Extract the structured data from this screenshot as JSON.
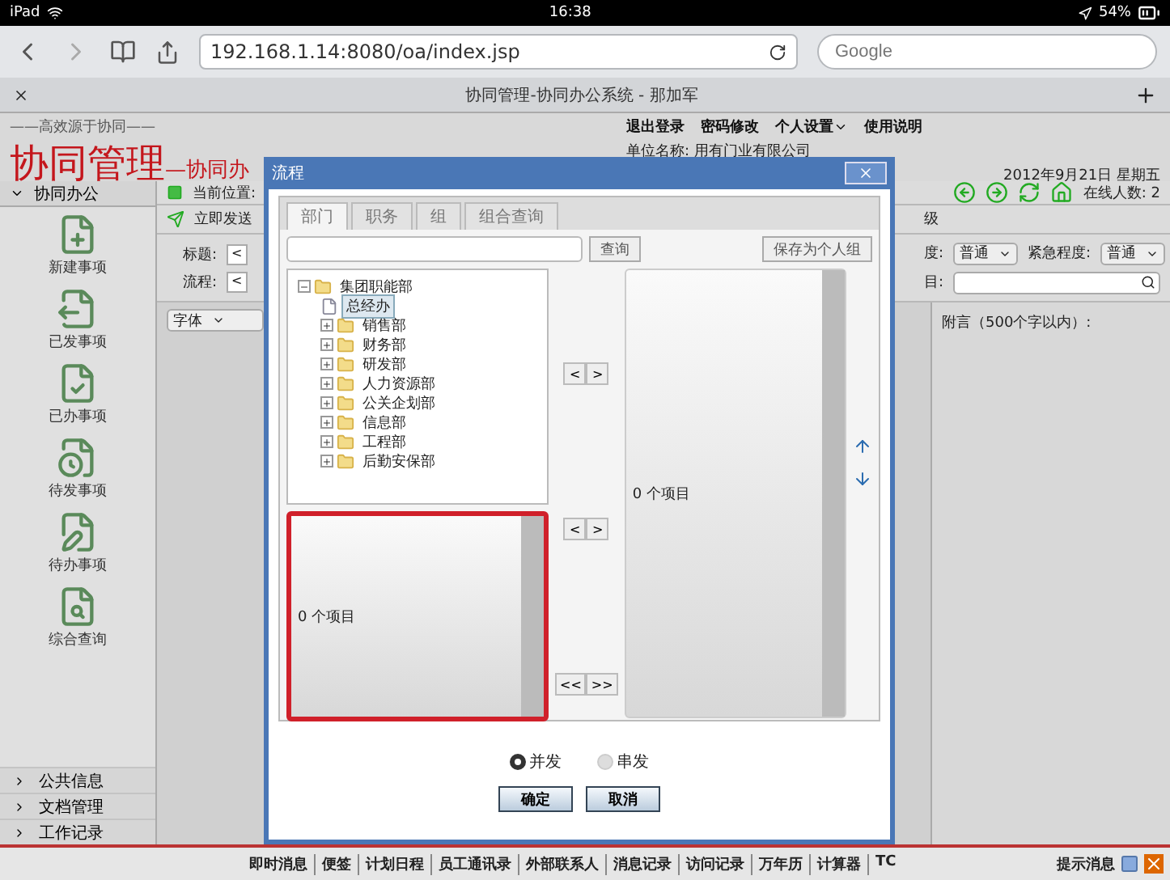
{
  "status_bar": {
    "device": "iPad",
    "time": "16:38",
    "battery": "54%"
  },
  "browser": {
    "url": "192.168.1.14:8080/oa/index.jsp",
    "search_placeholder": "Google",
    "tab_title": "协同管理-协同办公系统 - 那加军"
  },
  "header": {
    "tagline": "——高效源于协同——",
    "logo": "协同管理",
    "subtitle": "—协同办",
    "links": [
      {
        "label": "退出登录",
        "kind": "link"
      },
      {
        "label": "密码修改",
        "kind": "link"
      },
      {
        "label": "个人设置",
        "kind": "menu"
      },
      {
        "label": "使用说明",
        "kind": "link"
      }
    ],
    "company_label": "单位名称:",
    "company": "用有门业有限公司",
    "date": "2012年9月21日 星期五"
  },
  "sidebar": {
    "section": {
      "label": "协同办公",
      "expanded": true
    },
    "items": [
      {
        "label": "新建事项",
        "kind": "new"
      },
      {
        "label": "已发事项",
        "kind": "sent"
      },
      {
        "label": "已办事项",
        "kind": "done"
      },
      {
        "label": "待发事项",
        "kind": "pending"
      },
      {
        "label": "待办事项",
        "kind": "todo"
      },
      {
        "label": "综合查询",
        "kind": "search"
      }
    ],
    "groups": [
      {
        "label": "公共信息",
        "expanded": false
      },
      {
        "label": "文档管理",
        "expanded": false
      },
      {
        "label": "工作记录",
        "expanded": false
      }
    ]
  },
  "workspace": {
    "breadcrumb": "当前位置:",
    "online": "在线人数: 2",
    "send_button": "立即发送",
    "tab_fragment": "级",
    "title_label": "标题:",
    "title_value": "<",
    "flow_label": "流程:",
    "flow_value": "<",
    "importance_label": "度:",
    "importance_value": "普通",
    "urgency_label": "紧急程度:",
    "urgency_value": "普通",
    "project_label": "目:",
    "font_select": "字体",
    "note_label": "附言（500个字以内）:"
  },
  "dialog": {
    "title": "流程",
    "tabs": [
      {
        "label": "部门",
        "selected": true
      },
      {
        "label": "职务",
        "selected": false
      },
      {
        "label": "组",
        "selected": false
      },
      {
        "label": "组合查询",
        "selected": false
      }
    ],
    "search_button": "查询",
    "save_button": "保存为个人组",
    "tree": [
      {
        "label": "集团职能部",
        "kind": "folder",
        "expanded": true,
        "selected": false,
        "children": [
          {
            "label": "总经办",
            "kind": "leaf",
            "selected": true
          },
          {
            "label": "销售部",
            "kind": "folder",
            "expanded": false,
            "selected": false
          },
          {
            "label": "财务部",
            "kind": "folder",
            "expanded": false,
            "selected": false
          },
          {
            "label": "研发部",
            "kind": "folder",
            "expanded": false,
            "selected": false
          },
          {
            "label": "人力资源部",
            "kind": "folder",
            "expanded": false,
            "selected": false
          },
          {
            "label": "公关企划部",
            "kind": "folder",
            "expanded": false,
            "selected": false
          },
          {
            "label": "信息部",
            "kind": "folder",
            "expanded": false,
            "selected": false
          },
          {
            "label": "工程部",
            "kind": "folder",
            "expanded": false,
            "selected": false
          },
          {
            "label": "后勤安保部",
            "kind": "folder",
            "expanded": false,
            "selected": false
          }
        ]
      }
    ],
    "left_list": {
      "count": "0 个项目",
      "highlighted": true
    },
    "right_list": {
      "count": "0 个项目",
      "highlighted": false
    },
    "move_buttons": [
      [
        "<",
        ">"
      ],
      [
        "<",
        ">"
      ],
      [
        "<<",
        ">>"
      ]
    ],
    "modes": [
      {
        "label": "并发",
        "selected": true
      },
      {
        "label": "串发",
        "selected": false
      }
    ],
    "buttons": [
      "确定",
      "取消"
    ]
  },
  "footer": {
    "links": [
      "即时消息",
      "便签",
      "计划日程",
      "员工通讯录",
      "外部联系人",
      "消息记录",
      "访问记录",
      "万年历",
      "计算器",
      "TC"
    ],
    "notice": "提示消息"
  }
}
